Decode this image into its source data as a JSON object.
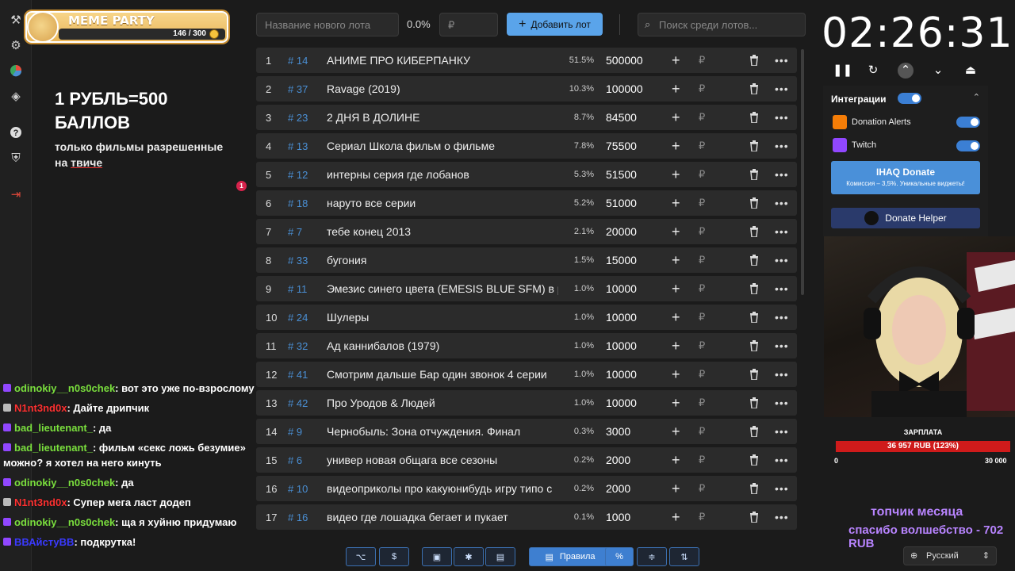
{
  "brand": {
    "title": "MEME PARTY",
    "count": "146 / 300"
  },
  "promo": {
    "line1": "1 РУБЛЬ=500 БАЛЛОВ",
    "line2": "только фильмы разрешенные",
    "line3a": "на ",
    "line3b": "твиче"
  },
  "notification_badge": "1",
  "chat": [
    {
      "user": "odinokiy__n0s0chek",
      "color": "green",
      "text": ": вот это уже по-взрослому"
    },
    {
      "user": "N1nt3nd0x",
      "color": "red",
      "text": ": Дайте дрипчик"
    },
    {
      "user": "bad_lieutenant_",
      "color": "green",
      "text": ": да"
    },
    {
      "user": "bad_lieutenant_",
      "color": "green",
      "text": ": фильм «секс ложь безумие» можно? я хотел на него кинуть"
    },
    {
      "user": "odinokiy__n0s0chek",
      "color": "green",
      "text": ": да"
    },
    {
      "user": "N1nt3nd0x",
      "color": "red",
      "text": ": Супер мега ласт додеп"
    },
    {
      "user": "odinokiy__n0s0chek",
      "color": "green",
      "text": ": ща я хуйню придумаю"
    },
    {
      "user": "ВВАйстуВВ",
      "color": "blue",
      "text": ": подкрутка!"
    }
  ],
  "toolbar": {
    "name_placeholder": "Название нового лота",
    "percent": "0.0%",
    "currency_placeholder": "₽",
    "add_label": "Добавить лот",
    "search_placeholder": "Поиск среди лотов..."
  },
  "lots": [
    {
      "n": "1",
      "id": "# 14",
      "name": "АНИМЕ ПРО КИБЕРПАНКУ",
      "pct": "51.5%",
      "amount": "500000"
    },
    {
      "n": "2",
      "id": "# 37",
      "name": "Ravage (2019)",
      "pct": "10.3%",
      "amount": "100000"
    },
    {
      "n": "3",
      "id": "# 23",
      "name": "2 ДНЯ В ДОЛИНЕ",
      "pct": "8.7%",
      "amount": "84500"
    },
    {
      "n": "4",
      "id": "# 13",
      "name": "Сериал Школа фильм о фильме",
      "pct": "7.8%",
      "amount": "75500"
    },
    {
      "n": "5",
      "id": "# 12",
      "name": "интерны серия где лобанов",
      "pct": "5.3%",
      "amount": "51500"
    },
    {
      "n": "6",
      "id": "# 18",
      "name": "наруто все серии",
      "pct": "5.2%",
      "amount": "51000"
    },
    {
      "n": "7",
      "id": "# 7",
      "name": "тебе конец 2013",
      "pct": "2.1%",
      "amount": "20000"
    },
    {
      "n": "8",
      "id": "# 33",
      "name": "бугония",
      "pct": "1.5%",
      "amount": "15000"
    },
    {
      "n": "9",
      "id": "# 11",
      "name": "Эмезис синего цвета (EMESIS BLUE SFM) в р",
      "pct": "1.0%",
      "amount": "10000"
    },
    {
      "n": "10",
      "id": "# 24",
      "name": "Шулеры",
      "pct": "1.0%",
      "amount": "10000"
    },
    {
      "n": "11",
      "id": "# 32",
      "name": "Ад каннибалов (1979)",
      "pct": "1.0%",
      "amount": "10000"
    },
    {
      "n": "12",
      "id": "# 41",
      "name": "Смотрим дальше Бар один звонок 4 серии",
      "pct": "1.0%",
      "amount": "10000"
    },
    {
      "n": "13",
      "id": "# 42",
      "name": "Про Уродов & Людей",
      "pct": "1.0%",
      "amount": "10000"
    },
    {
      "n": "14",
      "id": "# 9",
      "name": "Чернобыль: Зона отчуждения. Финал",
      "pct": "0.3%",
      "amount": "3000"
    },
    {
      "n": "15",
      "id": "# 6",
      "name": "универ новая общага все сезоны",
      "pct": "0.2%",
      "amount": "2000"
    },
    {
      "n": "16",
      "id": "# 10",
      "name": "видеоприколы про какуюнибудь игру типо с",
      "pct": "0.2%",
      "amount": "2000"
    },
    {
      "n": "17",
      "id": "# 16",
      "name": "видео где лошадка бегает и пукает",
      "pct": "0.1%",
      "amount": "1000"
    }
  ],
  "bottom": {
    "rules_label": "Правила"
  },
  "timer": "02:26:31",
  "integrations": {
    "title": "Интеграции",
    "items": [
      "Donation Alerts",
      "Twitch"
    ],
    "ihaq_title": "IHAQ Donate",
    "ihaq_sub": "Комиссия – 3,5%. Уникальные виджеты!",
    "donate_helper": "Donate Helper"
  },
  "salary": {
    "title": "ЗАРПЛАТА",
    "bar_text": "36 957 RUB (123%)",
    "min": "0",
    "max": "30 000",
    "progress": 1.23
  },
  "overlay": {
    "top_month": "топчик месяца",
    "thanks": "спасибо волшебство - 702 RUB"
  },
  "language": "Русский"
}
